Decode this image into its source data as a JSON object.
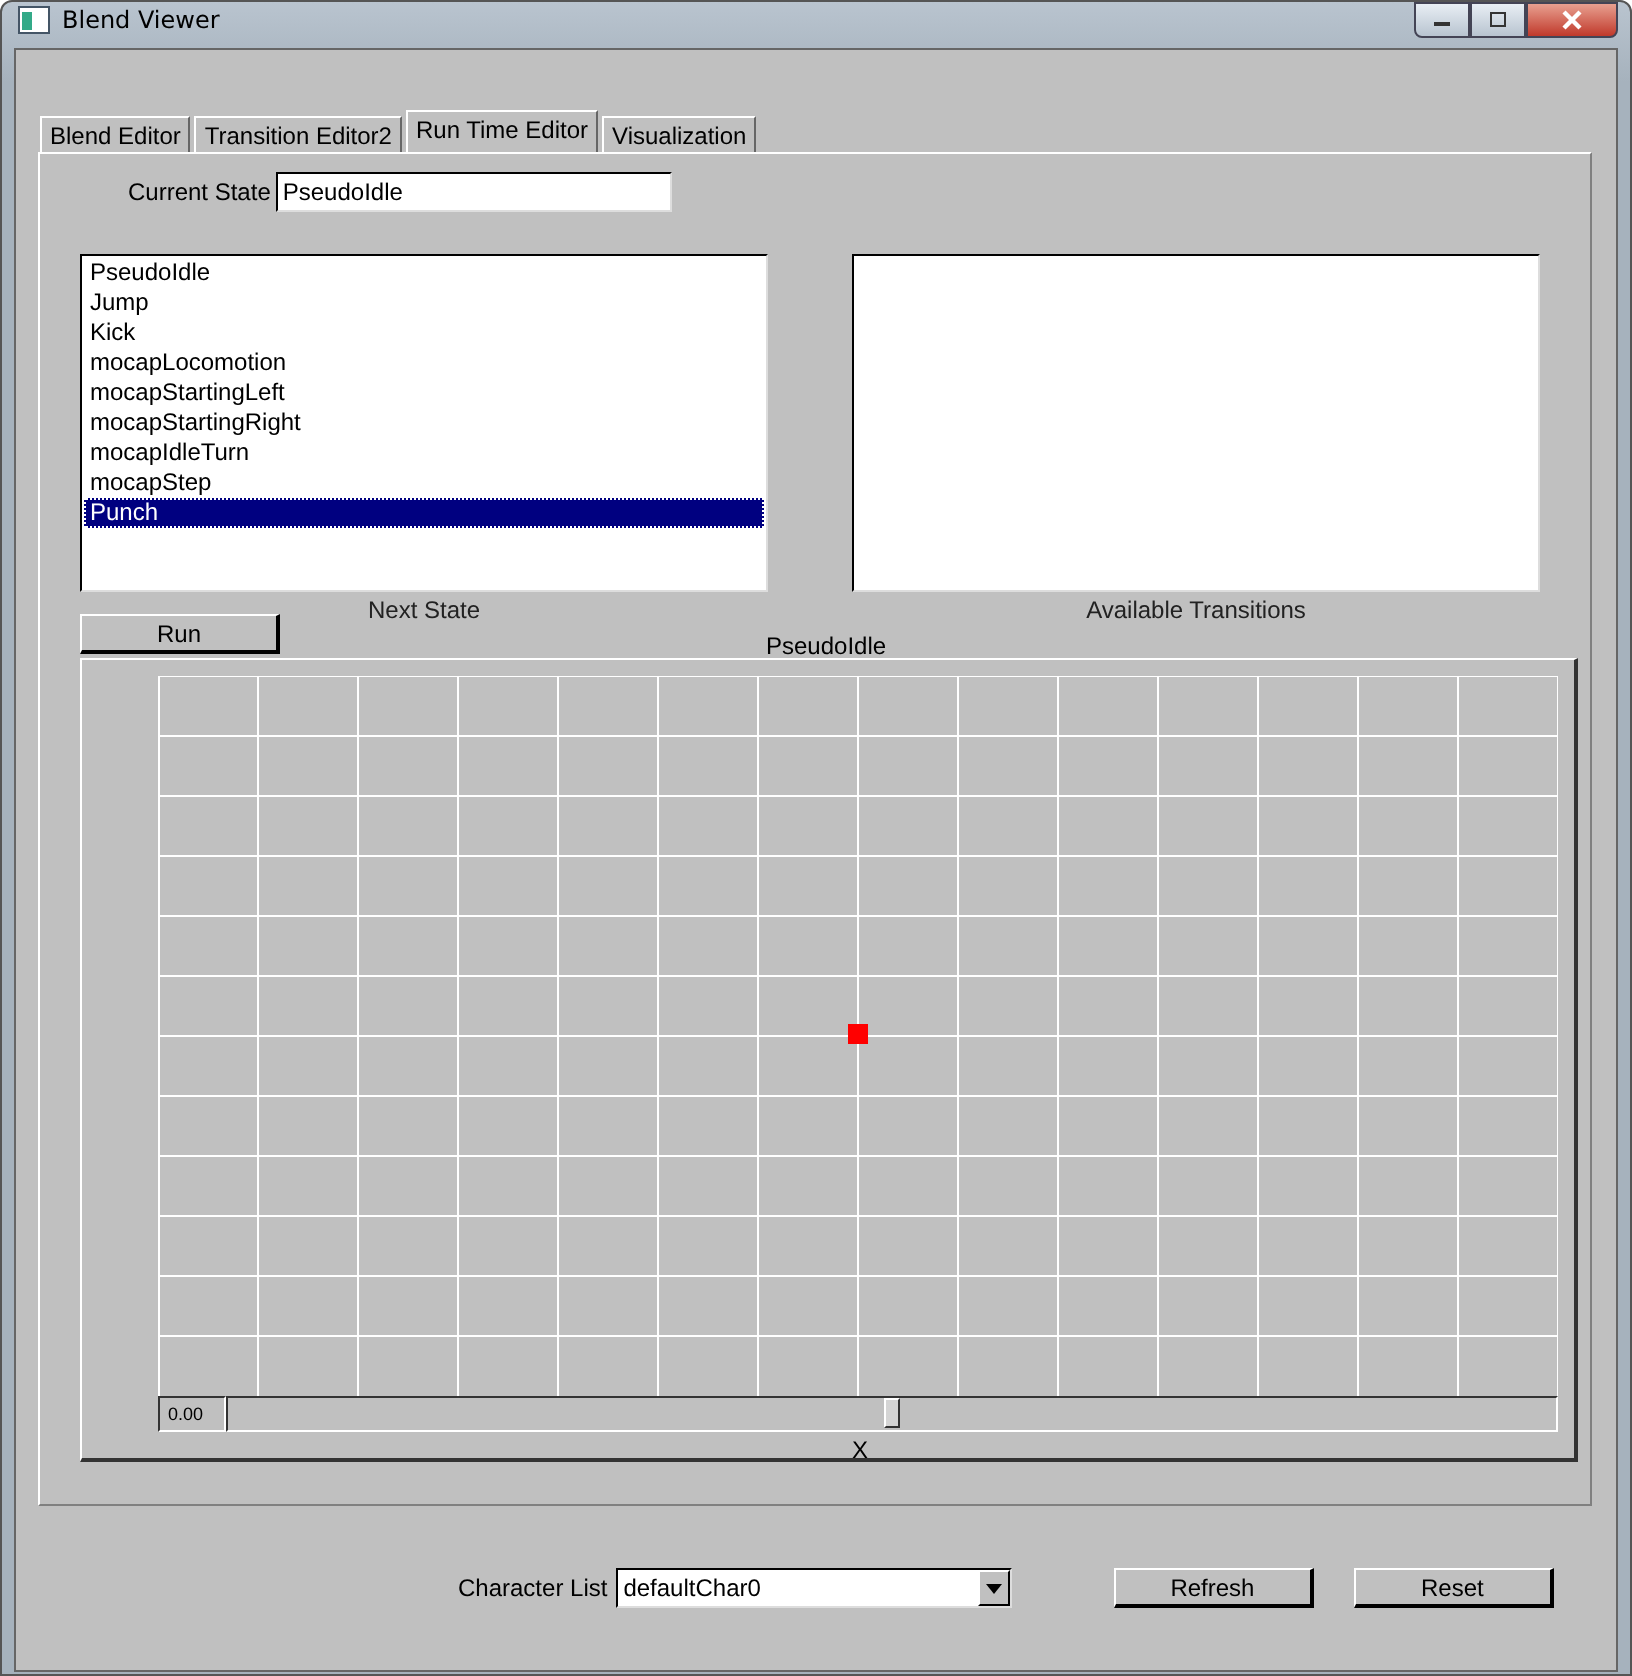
{
  "window": {
    "title": "Blend Viewer"
  },
  "tabs": [
    {
      "label": "Blend Editor",
      "selected": false
    },
    {
      "label": "Transition Editor2",
      "selected": false
    },
    {
      "label": "Run Time Editor",
      "selected": true
    },
    {
      "label": "Visualization",
      "selected": false
    }
  ],
  "current_state": {
    "label": "Current State",
    "value": "PseudoIdle"
  },
  "next_state": {
    "label": "Next State",
    "items": [
      {
        "label": "PseudoIdle",
        "selected": false
      },
      {
        "label": "Jump",
        "selected": false
      },
      {
        "label": "Kick",
        "selected": false
      },
      {
        "label": "mocapLocomotion",
        "selected": false
      },
      {
        "label": "mocapStartingLeft",
        "selected": false
      },
      {
        "label": "mocapStartingRight",
        "selected": false
      },
      {
        "label": "mocapIdleTurn",
        "selected": false
      },
      {
        "label": "mocapStep",
        "selected": false
      },
      {
        "label": "Punch",
        "selected": true
      }
    ]
  },
  "available_transitions": {
    "label": "Available Transitions"
  },
  "run_button": "Run",
  "plot": {
    "title": "PseudoIdle",
    "slider_value": "0.00",
    "slider": {
      "level": 0.5
    },
    "axis_label": "X"
  },
  "character_list": {
    "label": "Character List",
    "value": "defaultChar0"
  },
  "buttons": [
    "Refresh",
    "Reset"
  ]
}
